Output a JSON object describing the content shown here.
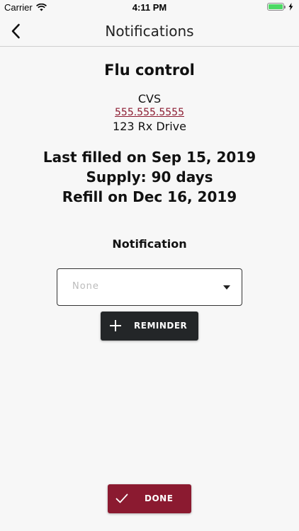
{
  "status_bar": {
    "carrier": "Carrier",
    "time": "4:11 PM",
    "battery_level": 1.0
  },
  "nav": {
    "title": "Notifications",
    "back_icon": "chevron-left-icon"
  },
  "medication": {
    "name": "Flu control",
    "pharmacy": "CVS",
    "phone": "555.555.5555",
    "address": "123 Rx Drive",
    "last_filled": "Last filled on Sep 15, 2019",
    "supply": "Supply: 90 days",
    "refill": "Refill on Dec 16, 2019"
  },
  "notification": {
    "label": "Notification",
    "selected": "None"
  },
  "buttons": {
    "reminder_label": "REMINDER",
    "done_label": "DONE"
  },
  "colors": {
    "accent": "#8b1a30",
    "dark_button": "#232628",
    "battery": "#4cd964"
  }
}
